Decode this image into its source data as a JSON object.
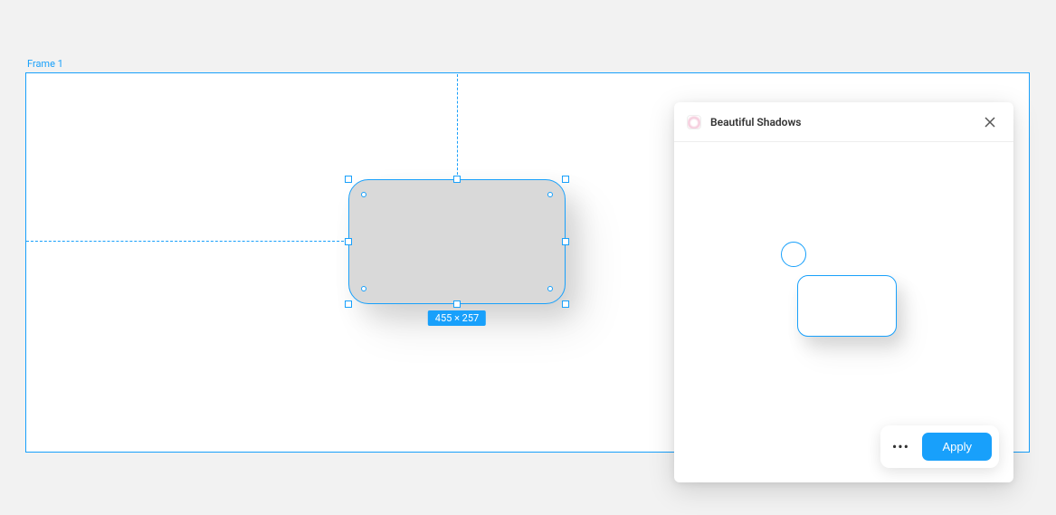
{
  "canvas": {
    "frame_label": "Frame 1",
    "selection_size": "455 × 257"
  },
  "plugin": {
    "title": "Beautiful Shadows",
    "actions": {
      "apply": "Apply"
    }
  }
}
